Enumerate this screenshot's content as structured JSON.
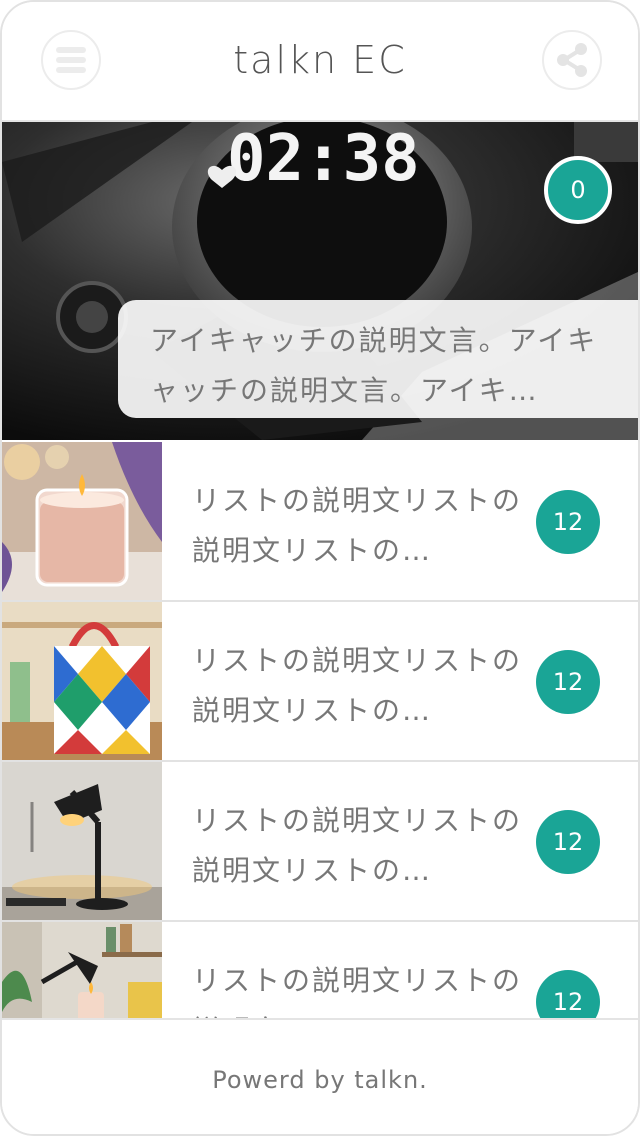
{
  "header": {
    "title": "talkn EC",
    "menu_icon": "hamburger-menu-icon",
    "share_icon": "share-icon"
  },
  "hero": {
    "image_icon": "smartwatch-photo",
    "description": "アイキャッチの説明文言。アイキャッチの説明文言。アイキ…",
    "count": "0",
    "watch_time": "02:38"
  },
  "list": {
    "items": [
      {
        "image": "candle-photo",
        "text": "リストの説明文リストの説明文リストの…",
        "count": "12"
      },
      {
        "image": "tote-bag-photo",
        "text": "リストの説明文リストの説明文リストの…",
        "count": "12"
      },
      {
        "image": "desk-lamp-photo",
        "text": "リストの説明文リストの説明文リストの…",
        "count": "12"
      },
      {
        "image": "interior-lamp-photo",
        "text": "リストの説明文リストの説明文リストの…",
        "count": "12"
      }
    ]
  },
  "footer": {
    "text": "Powerd by talkn."
  },
  "colors": {
    "accent": "#1aa596",
    "border": "#e2e2e2",
    "text": "#777777"
  }
}
